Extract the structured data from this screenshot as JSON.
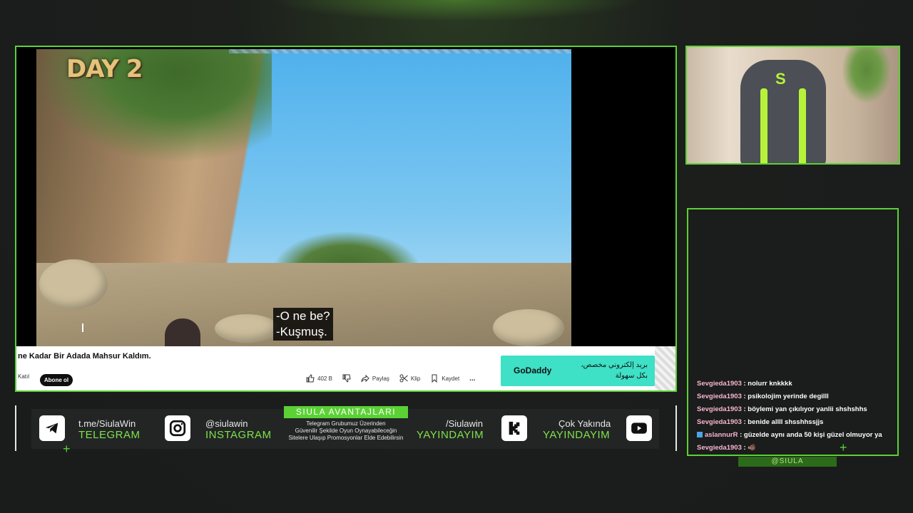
{
  "video": {
    "day_tag": "DAY 2",
    "subtitle": "-O ne be?\n-Kuşmuş.",
    "title": "ne Kadar Bir Adada Mahsur Kaldım.",
    "join_label": "Katıl",
    "subscribe_label": "Abone ol",
    "actions": {
      "likes": "402 B",
      "share": "Paylaş",
      "clip": "Klip",
      "save": "Kaydet",
      "more": "..."
    },
    "ad": {
      "brand": "GoDaddy",
      "text": "بريد إلكتروني مخصص، بكل سهولة"
    }
  },
  "social": {
    "telegram": {
      "handle": "t.me/SiulaWin",
      "label": "TELEGRAM",
      "icon": "telegram-icon"
    },
    "instagram": {
      "handle": "@siulawin",
      "label": "INSTAGRAM",
      "icon": "instagram-icon"
    },
    "youtube_site": {
      "handle": "/Siulawin",
      "label": "YAYINDAYIM",
      "icon": "kick-icon"
    },
    "youtube": {
      "handle": "Çok Yakında",
      "label": "YAYINDAYIM",
      "icon": "youtube-icon"
    }
  },
  "avantaj": {
    "title": "SIULA AVANTAJLARI",
    "line1": "Telegram Grubumuz Üzerinden",
    "line2": "Güvenilir Şekilde Oyun Oynayabileceğin",
    "line3": "Sitelere Ulaşıp Promosyonlar Elde Edebilirsin"
  },
  "chat": {
    "messages": [
      {
        "user": "Sevgieda1903",
        "text": ": nolurr knkkkk"
      },
      {
        "user": "Sevgieda1903",
        "text": ": psikolojim yerinde degilll"
      },
      {
        "user": "Sevgieda1903",
        "text": ": böylemi yan çıkılıyor yanlii shshshhs"
      },
      {
        "user": "Sevgieda1903",
        "text": ": benide allll shsshhssjjs"
      },
      {
        "user": "aslannurR",
        "text": ": güzelde aynı anda 50 kişi güzel olmuyor ya"
      },
      {
        "user": "Sevgieda1903",
        "text": ": 🐗"
      }
    ],
    "tag": "@SIULA"
  },
  "colors": {
    "accent": "#5bd136",
    "chat_user": "#f7b7d0",
    "ad_bg": "#3ee0c6"
  }
}
